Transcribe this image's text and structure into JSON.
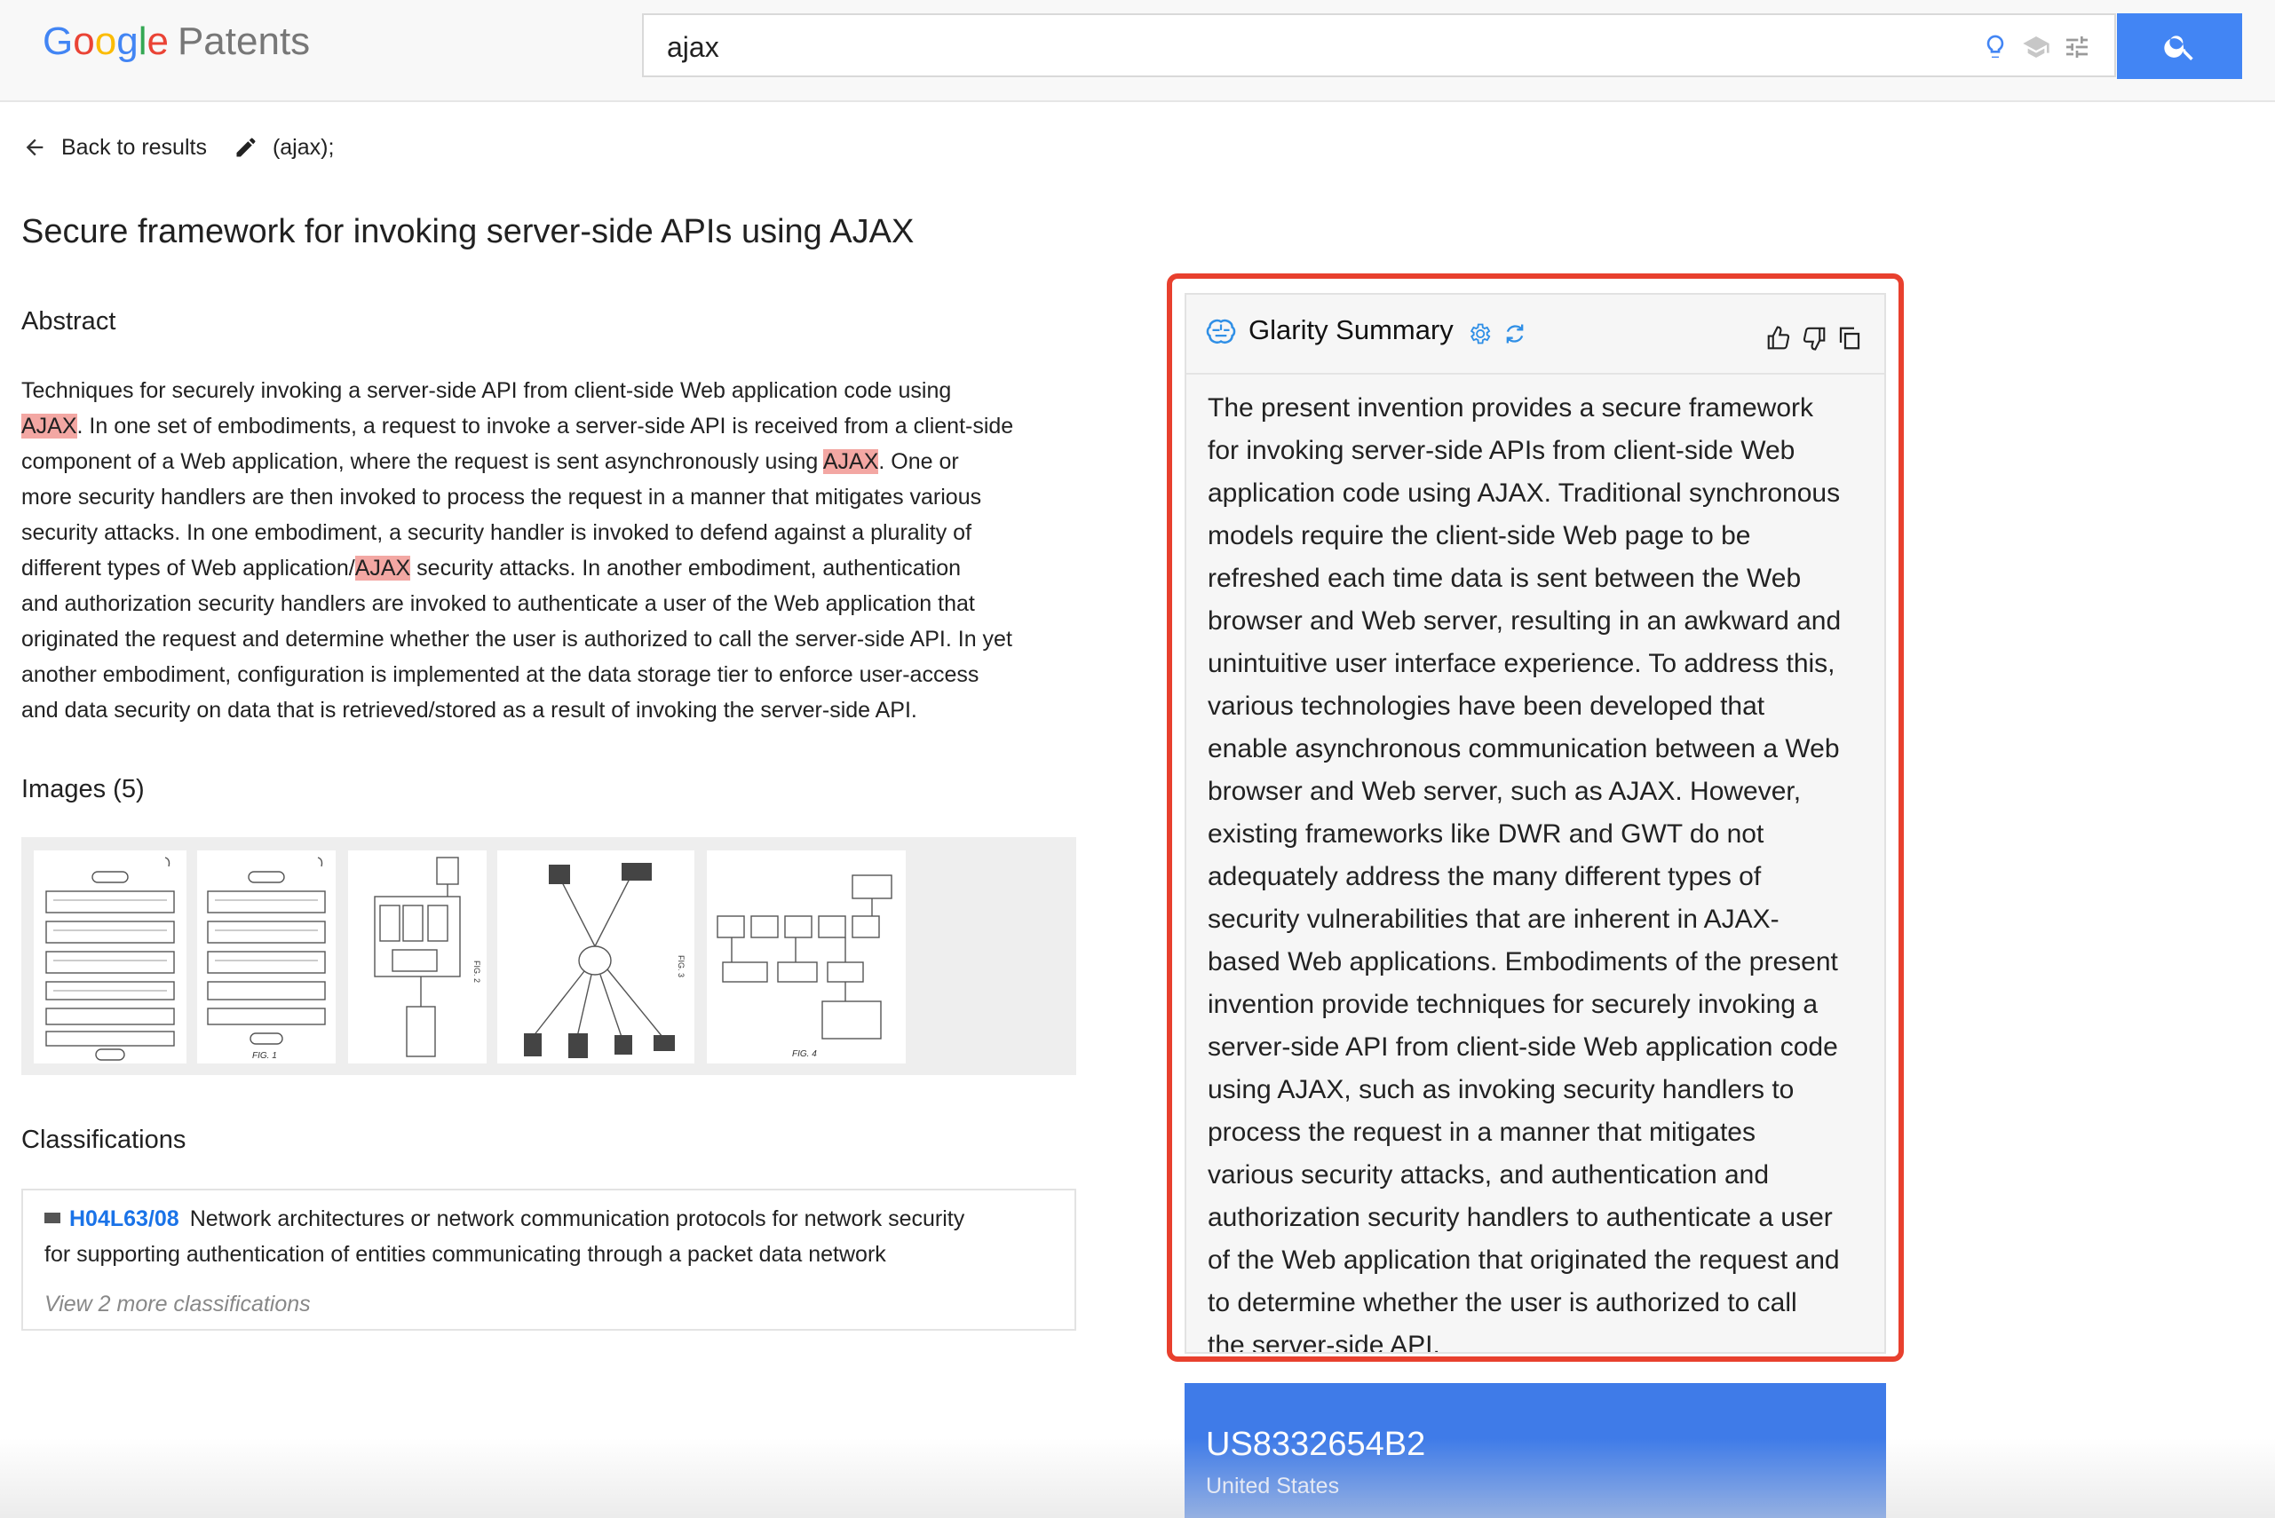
{
  "header": {
    "logo_google": [
      "G",
      "o",
      "o",
      "g",
      "l",
      "e"
    ],
    "logo_product": "Patents",
    "search_value": "ajax"
  },
  "nav": {
    "back_label": "Back to results",
    "query_label": "(ajax);"
  },
  "patent": {
    "title": "Secure framework for invoking server-side APIs using AJAX",
    "abstract_heading": "Abstract",
    "abstract_lines": [
      [
        "Techniques for securely invoking a server-side API from client-side Web application code using"
      ],
      [
        "",
        "AJAX",
        ". In one set of embodiments, a request to invoke a server-side API is received from a client-side"
      ],
      [
        "component of a Web application, where the request is sent asynchronously using ",
        "AJAX",
        ". One or"
      ],
      [
        "more security handlers are then invoked to process the request in a manner that mitigates various"
      ],
      [
        "security attacks. In one embodiment, a security handler is invoked to defend against a plurality of"
      ],
      [
        "different types of Web application/",
        "AJAX",
        " security attacks. In another embodiment, authentication"
      ],
      [
        "and authorization security handlers are invoked to authenticate a user of the Web application that"
      ],
      [
        "originated the request and determine whether the user is authorized to call the server-side API. In yet"
      ],
      [
        "another embodiment, configuration is implemented at the data storage tier to enforce user-access"
      ],
      [
        "and data security on data that is retrieved/stored as a result of invoking the server-side API."
      ]
    ],
    "images_heading": "Images (5)",
    "classifications_heading": "Classifications",
    "classification": {
      "code": "H04L63/08",
      "text_line1": "Network architectures or network communication protocols for network security",
      "text_line2": "for supporting authentication of entities communicating through a packet data network",
      "more": "View 2 more classifications"
    }
  },
  "glarity": {
    "title": "Glarity Summary",
    "summary_lines": [
      "The present invention provides a secure framework",
      "for invoking server-side APIs from client-side Web",
      "application code using AJAX. Traditional synchronous",
      "models require the client-side Web page to be",
      "refreshed each time data is sent between the Web",
      "browser and Web server, resulting in an awkward and",
      "unintuitive user interface experience. To address this,",
      "various technologies have been developed that",
      "enable asynchronous communication between a Web",
      "browser and Web server, such as AJAX. However,",
      "existing frameworks like DWR and GWT do not",
      "adequately address the many different types of",
      "security vulnerabilities that are inherent in AJAX-",
      "based Web applications. Embodiments of the present",
      "invention provide techniques for securely invoking a",
      "server-side API from client-side Web application code",
      "using AJAX, such as invoking security handlers to",
      "process the request in a manner that mitigates",
      "various security attacks, and authentication and",
      "authorization security handlers to authenticate a user",
      "of the Web application that originated the request and",
      "to determine whether the user is authorized to call",
      "the server-side API."
    ]
  },
  "patent_card": {
    "number": "US8332654B2",
    "country": "United States"
  },
  "colors": {
    "brand_blue": "#4285f4",
    "highlight": "#f3a7a3",
    "frame_red": "#e8402e",
    "card_blue": "#3f7be8"
  },
  "icons": [
    "arrow-left-icon",
    "pencil-icon",
    "lightbulb-icon",
    "school-icon",
    "tune-icon",
    "search-icon",
    "brain-icon",
    "gear-icon",
    "refresh-icon",
    "thumbs-up-icon",
    "thumbs-down-icon",
    "copy-icon",
    "label-icon"
  ]
}
